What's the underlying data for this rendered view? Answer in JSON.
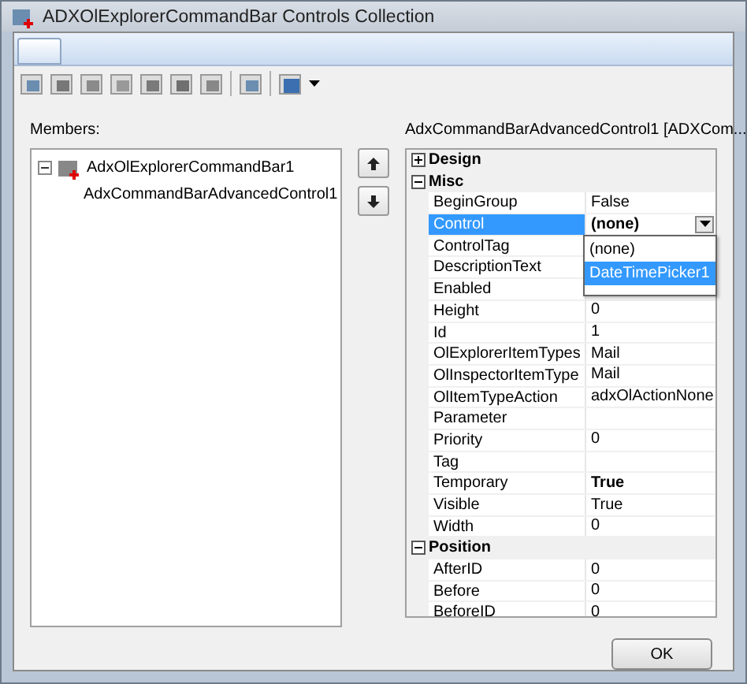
{
  "window": {
    "title": "ADXOlExplorerCommandBar Controls Collection"
  },
  "members": {
    "label": "Members:",
    "tree": [
      {
        "label": "AdxOlExplorerCommandBar1",
        "expanded": true,
        "children": [
          {
            "label": "AdxCommandBarAdvancedControl1"
          }
        ]
      }
    ]
  },
  "properties": {
    "title": "AdxCommandBarAdvancedControl1 [ADXCom...",
    "rows": [
      {
        "kind": "category",
        "name": "Design",
        "expanded": false
      },
      {
        "kind": "category",
        "name": "Misc",
        "expanded": true
      },
      {
        "kind": "property",
        "name": "BeginGroup",
        "value": "False",
        "selected": false,
        "bold": false
      },
      {
        "kind": "property",
        "name": "Control",
        "value": "(none)",
        "selected": true,
        "bold": true
      },
      {
        "kind": "property",
        "name": "ControlTag",
        "selected": false
      },
      {
        "kind": "property",
        "name": "DescriptionText",
        "selected": false
      },
      {
        "kind": "property",
        "name": "Enabled",
        "selected": false
      },
      {
        "kind": "property",
        "name": "Height",
        "value": "0",
        "selected": false,
        "bold": false
      },
      {
        "kind": "property",
        "name": "Id",
        "value": "1",
        "selected": false,
        "bold": false
      },
      {
        "kind": "property",
        "name": "OlExplorerItemTypes",
        "value": "Mail",
        "selected": false,
        "bold": false
      },
      {
        "kind": "property",
        "name": "OlInspectorItemType",
        "value": "Mail",
        "selected": false,
        "bold": false
      },
      {
        "kind": "property",
        "name": "OlItemTypeAction",
        "value": "adxOlActionNone",
        "selected": false,
        "bold": false
      },
      {
        "kind": "property",
        "name": "Parameter",
        "selected": false
      },
      {
        "kind": "property",
        "name": "Priority",
        "value": "0",
        "selected": false,
        "bold": false
      },
      {
        "kind": "property",
        "name": "Tag",
        "selected": false
      },
      {
        "kind": "property",
        "name": "Temporary",
        "value": "True",
        "selected": false,
        "bold": true
      },
      {
        "kind": "property",
        "name": "Visible",
        "value": "True",
        "selected": false,
        "bold": false
      },
      {
        "kind": "property",
        "name": "Width",
        "value": "0",
        "selected": false,
        "bold": false
      },
      {
        "kind": "category",
        "name": "Position",
        "expanded": true
      },
      {
        "kind": "property",
        "name": "AfterID",
        "value": "0",
        "selected": false,
        "bold": false
      },
      {
        "kind": "property",
        "name": "Before",
        "value": "0",
        "selected": false,
        "bold": false
      },
      {
        "kind": "property",
        "name": "BeforeID",
        "value": "0",
        "selected": false,
        "bold": false
      }
    ],
    "dropdown": [
      {
        "label": "(none)",
        "selected": false
      },
      {
        "label": "DateTimePicker1",
        "selected": true
      }
    ]
  },
  "buttons": [
    {
      "label": "OK"
    }
  ]
}
